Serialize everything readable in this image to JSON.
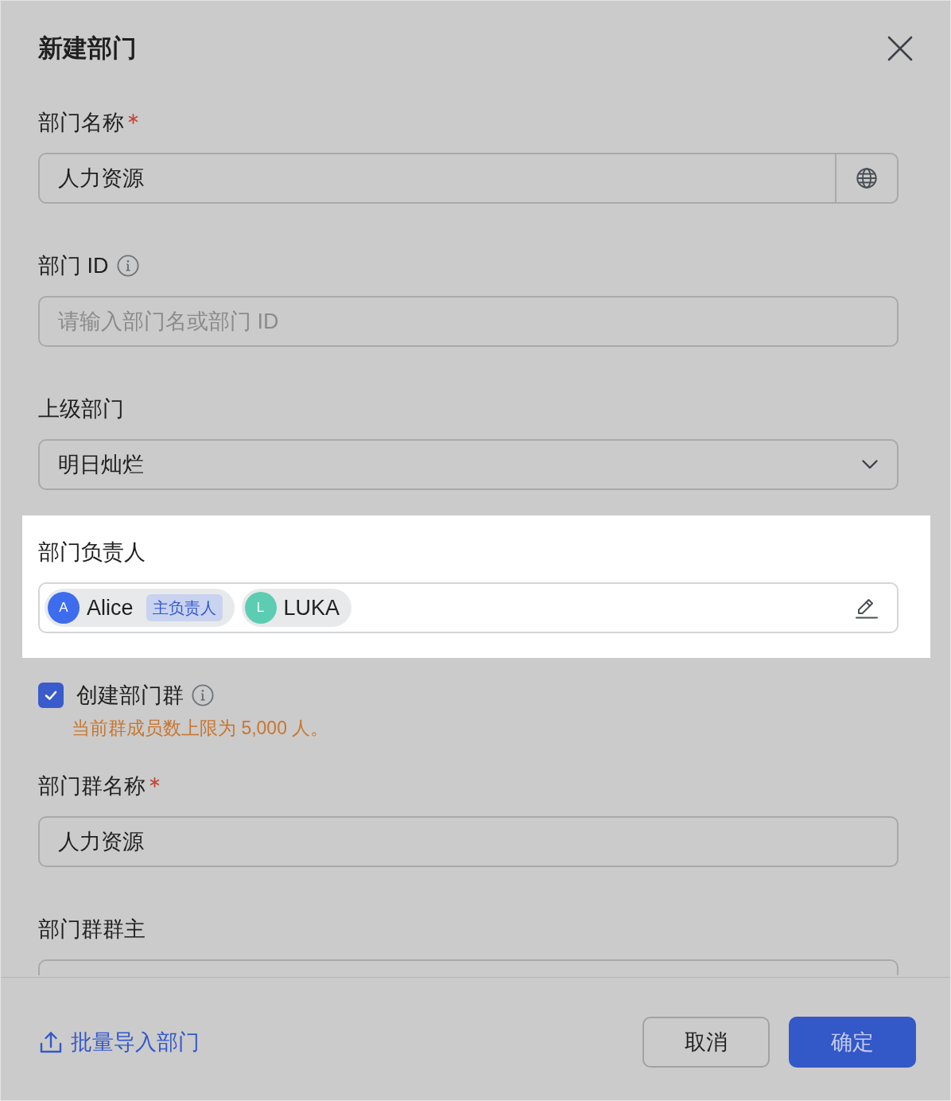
{
  "dialog": {
    "title": "新建部门"
  },
  "fields": [
    {
      "kind": "localized",
      "label": "部门名称",
      "required": true,
      "info": false,
      "value": "人力资源"
    },
    {
      "kind": "text",
      "label": "部门 ID",
      "required": false,
      "info": true,
      "placeholder": "请输入部门名或部门 ID"
    },
    {
      "kind": "select",
      "label": "上级部门",
      "required": false,
      "info": false,
      "value": "明日灿烂"
    },
    {
      "kind": "members",
      "label": "部门负责人",
      "required": false,
      "info": false,
      "highlighted": true,
      "members": [
        {
          "initial": "A",
          "name": "Alice",
          "tag": "主负责人",
          "color": "#3d6cef"
        },
        {
          "initial": "L",
          "name": "LUKA",
          "color": "#5ccdb2"
        }
      ]
    },
    {
      "kind": "checkbox",
      "label": "创建部门群",
      "required": false,
      "info": true,
      "checked": true,
      "note": "当前群成员数上限为 5,000 人。"
    },
    {
      "kind": "text",
      "label": "部门群名称",
      "required": true,
      "info": false,
      "value": "人力资源"
    },
    {
      "kind": "partial",
      "label": "部门群群主",
      "required": false,
      "info": false
    }
  ],
  "footer": {
    "link": "批量导入部门",
    "buttons": [
      {
        "kind": "secondary",
        "label": "取消"
      },
      {
        "kind": "primary",
        "label": "确定"
      }
    ]
  }
}
